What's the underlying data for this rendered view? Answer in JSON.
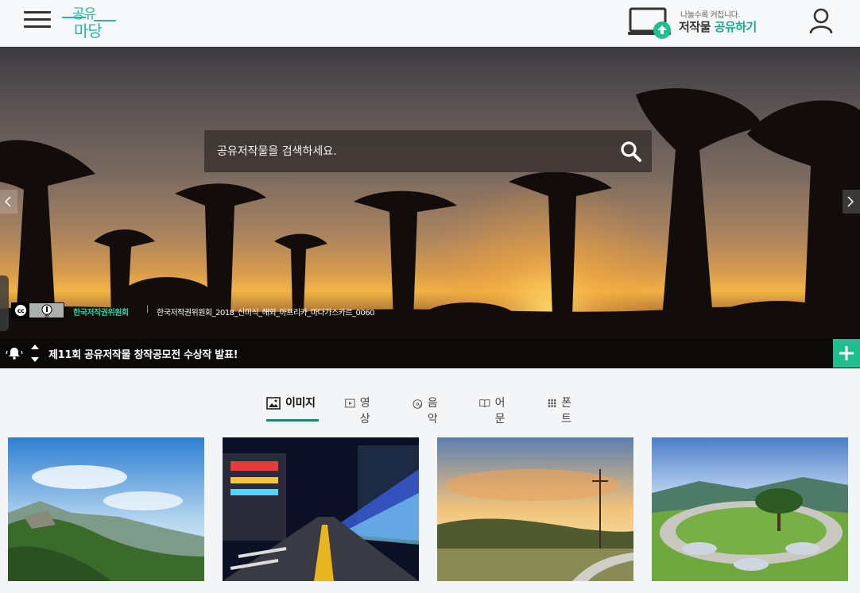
{
  "header": {
    "logo_line1": "공유",
    "logo_line2": "마당",
    "upload_sub": "나눌수록 커집니다.",
    "upload_main": "저작물",
    "upload_accent": "공유하기"
  },
  "hero": {
    "search_placeholder": "공유저작물을 검색하세요.",
    "credit_owner": "한국저작권위원회",
    "credit_separator": "|",
    "credit_filename": "한국저작권위원회_2018_신미식_해외_아프리카_마다가스카르_0060",
    "license_text": "BY",
    "notice_text": "제11회 공유저작물 창작공모전 수상작 발표!"
  },
  "tabs": [
    {
      "label": "이미지",
      "icon": "image-icon",
      "active": true
    },
    {
      "label": "영상",
      "icon": "video-icon",
      "active": false
    },
    {
      "label": "음악",
      "icon": "music-icon",
      "active": false
    },
    {
      "label": "어문",
      "icon": "book-icon",
      "active": false
    },
    {
      "label": "폰트",
      "icon": "grid-icon",
      "active": false
    }
  ],
  "colors": {
    "brand": "#2bb4a3",
    "accent_green": "#1aa88d",
    "tab_underline": "#168a6f",
    "plus_button": "#1fbf8f"
  }
}
